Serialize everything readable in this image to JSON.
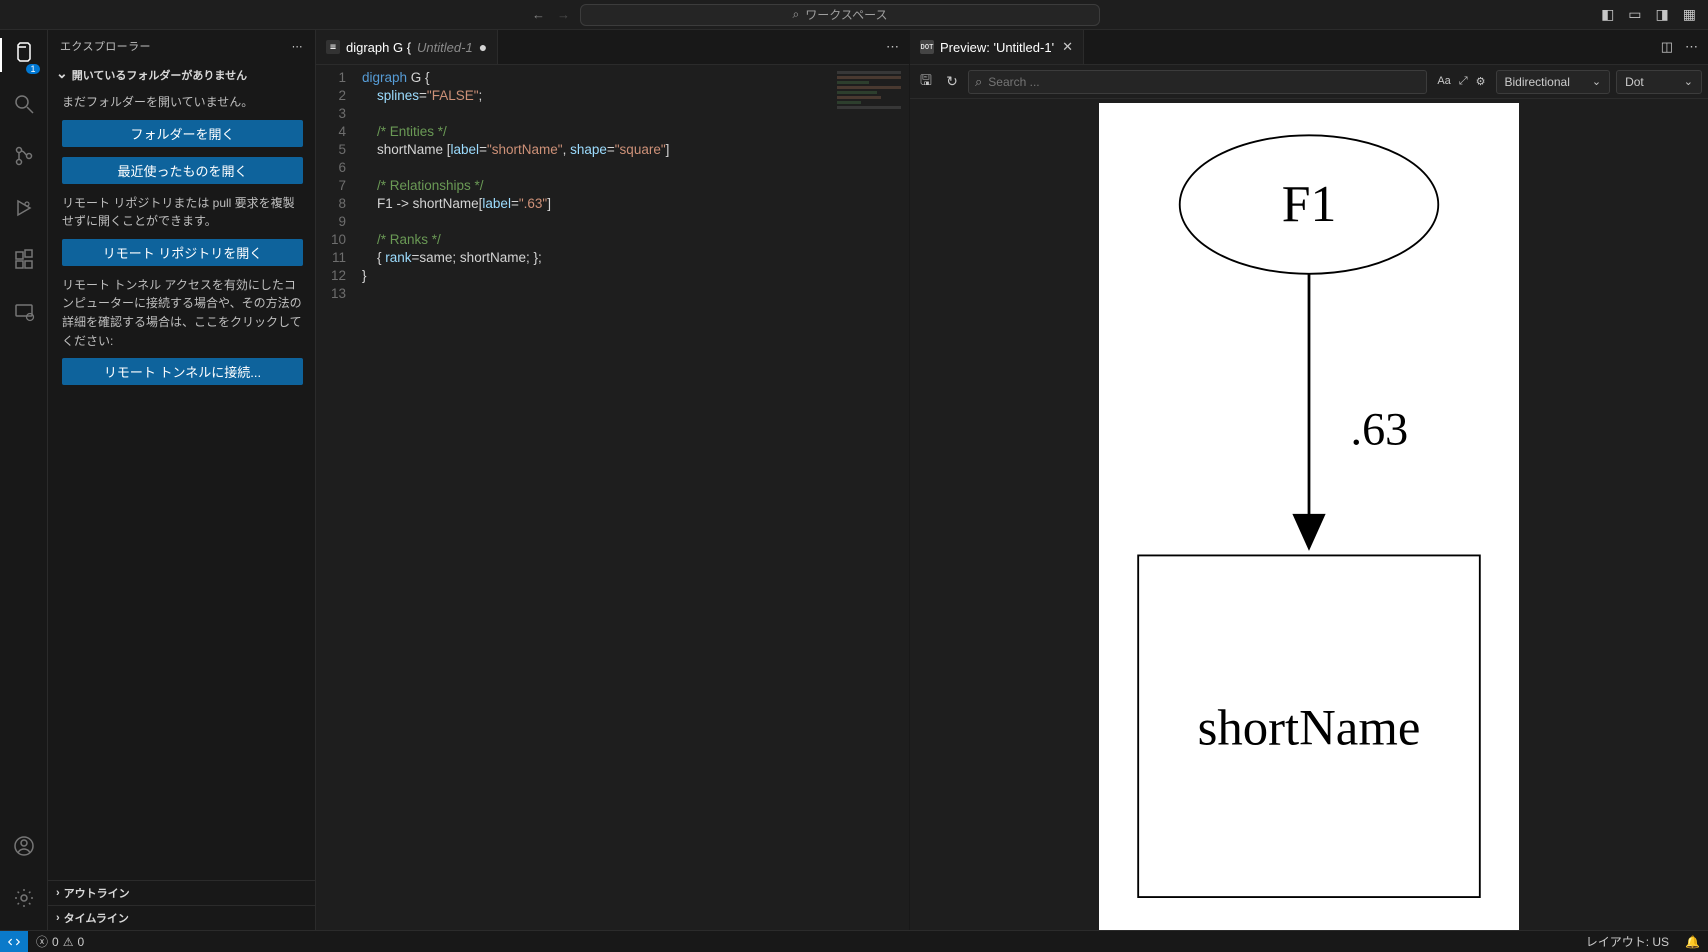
{
  "command_center": {
    "placeholder": "ワークスペース"
  },
  "sidebar": {
    "title": "エクスプローラー",
    "empty_folder_header": "開いているフォルダーがありません",
    "no_folder_msg": "まだフォルダーを開いていません。",
    "btn_open_folder": "フォルダーを開く",
    "btn_open_recent": "最近使ったものを開く",
    "remote_repo_msg": "リモート リポジトリまたは pull 要求を複製せずに開くことができます。",
    "btn_open_remote": "リモート リポジトリを開く",
    "tunnel_msg": "リモート トンネル アクセスを有効にしたコンピューターに接続する場合や、その方法の詳細を確認する場合は、ここをクリックしてください:",
    "btn_tunnel": "リモート トンネルに接続...",
    "outline": "アウトライン",
    "timeline": "タイムライン"
  },
  "editor_tab": {
    "title": "digraph G {",
    "unsaved_name": "Untitled-1"
  },
  "preview_tab": {
    "title": "Preview: 'Untitled-1'"
  },
  "code": {
    "lines": [
      1,
      2,
      3,
      4,
      5,
      6,
      7,
      8,
      9,
      10,
      11,
      12,
      13
    ]
  },
  "code_tokens": {
    "l1a": "digraph",
    "l1b": " G {",
    "l2a": "    splines",
    "l2eq": "=",
    "l2s": "\"FALSE\"",
    "l2sc": ";",
    "l4c": "    /* Entities */",
    "l5a": "    shortName [",
    "l5b": "label",
    "l5eq": "=",
    "l5s": "\"shortName\"",
    "l5cm": ", ",
    "l5c": "shape",
    "l5eq2": "=",
    "l5s2": "\"square\"",
    "l5end": "]",
    "l7c": "    /* Relationships */",
    "l8a": "    F1 -> shortName[",
    "l8b": "label",
    "l8eq": "=",
    "l8s": "\".63\"",
    "l8end": "]",
    "l10c": "    /* Ranks */",
    "l11a": "    { ",
    "l11b": "rank",
    "l11eq": "=",
    "l11c": "same; shortName; };",
    "l12": "}"
  },
  "preview_toolbar": {
    "search_placeholder": "Search ...",
    "dd_dir": "Bidirectional",
    "dd_engine": "Dot"
  },
  "graph": {
    "node_top": "F1",
    "edge_label": ".63",
    "node_bottom": "shortName"
  },
  "status": {
    "errors": "0",
    "warnings": "0",
    "layout": "レイアウト: US"
  },
  "activity_badge": "1"
}
